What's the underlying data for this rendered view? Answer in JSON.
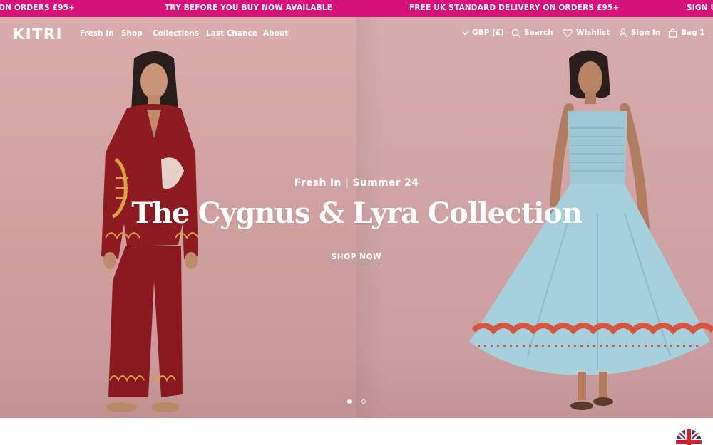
{
  "announcement": {
    "messages": [
      "ON ORDERS £95+",
      "TRY BEFORE YOU BUY NOW AVAILABLE",
      "FREE UK STANDARD DELIVERY ON ORDERS £95+",
      "SIGN U"
    ],
    "background_color": "#d6127a"
  },
  "header": {
    "logo": "KITRI",
    "nav": [
      "Fresh In",
      "Shop",
      "Collections",
      "Last Chance",
      "About"
    ],
    "currency": "GBP (£)",
    "search_label": "Search",
    "wishlist_label": "Wishlist",
    "signin_label": "Sign In",
    "bag_label": "Bag 1",
    "icons": [
      "chevron-down-icon",
      "search-icon",
      "heart-icon",
      "user-icon",
      "bag-icon"
    ]
  },
  "hero": {
    "eyebrow": "Fresh In | Summer 24",
    "headline": "The Cygnus & Lyra Collection",
    "cta": "SHOP NOW",
    "slides_total": 2,
    "active_slide": 1
  },
  "footer_widget": {
    "icon": "uk-flag-icon"
  }
}
